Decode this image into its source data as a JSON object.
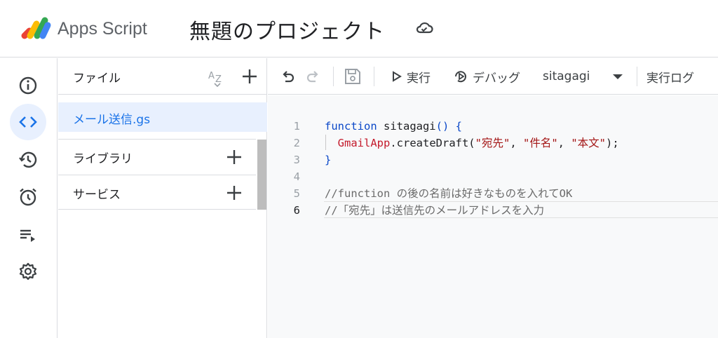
{
  "header": {
    "app_name": "Apps Script",
    "project_title": "無題のプロジェクト"
  },
  "rail": {
    "items": [
      {
        "name": "overview",
        "icon": "info-icon",
        "active": false
      },
      {
        "name": "editor",
        "icon": "code-icon",
        "active": true
      },
      {
        "name": "executions-history",
        "icon": "history-icon",
        "active": false
      },
      {
        "name": "triggers",
        "icon": "alarm-icon",
        "active": false
      },
      {
        "name": "executions",
        "icon": "playlist-icon",
        "active": false
      },
      {
        "name": "settings",
        "icon": "gear-icon",
        "active": false
      }
    ]
  },
  "files": {
    "header_label": "ファイル",
    "items": [
      {
        "label": "メール送信.gs",
        "selected": true
      }
    ],
    "sections": [
      {
        "label": "ライブラリ"
      },
      {
        "label": "サービス"
      }
    ]
  },
  "toolbar": {
    "run_label": "実行",
    "debug_label": "デバッグ",
    "function_select": "sitagagi",
    "log_label": "実行ログ"
  },
  "code": {
    "current_line": 6,
    "lines": [
      {
        "n": "1",
        "tokens": [
          {
            "t": "function",
            "c": "kw"
          },
          {
            "t": " sitagagi",
            "c": "fn"
          },
          {
            "t": "() {",
            "c": "kw"
          }
        ]
      },
      {
        "n": "2",
        "tokens": [
          {
            "t": "  ",
            "c": "fn"
          },
          {
            "t": "GmailApp",
            "c": "id"
          },
          {
            "t": ".createDraft(",
            "c": "fn"
          },
          {
            "t": "\"宛先\"",
            "c": "str"
          },
          {
            "t": ", ",
            "c": "fn"
          },
          {
            "t": "\"件名\"",
            "c": "str"
          },
          {
            "t": ", ",
            "c": "fn"
          },
          {
            "t": "\"本文\"",
            "c": "str"
          },
          {
            "t": ");",
            "c": "fn"
          }
        ]
      },
      {
        "n": "3",
        "tokens": [
          {
            "t": "}",
            "c": "kw"
          }
        ]
      },
      {
        "n": "4",
        "tokens": []
      },
      {
        "n": "5",
        "tokens": [
          {
            "t": "//function の後の名前は好きなものを入れてOK",
            "c": "cm"
          }
        ]
      },
      {
        "n": "6",
        "tokens": [
          {
            "t": "//「宛先」は送信先のメールアドレスを入力",
            "c": "cm"
          }
        ]
      }
    ]
  },
  "colors": {
    "accent": "#1a73e8",
    "active_bg": "#e8f0fe",
    "keyword": "#0b48c8",
    "string": "#a31515"
  }
}
